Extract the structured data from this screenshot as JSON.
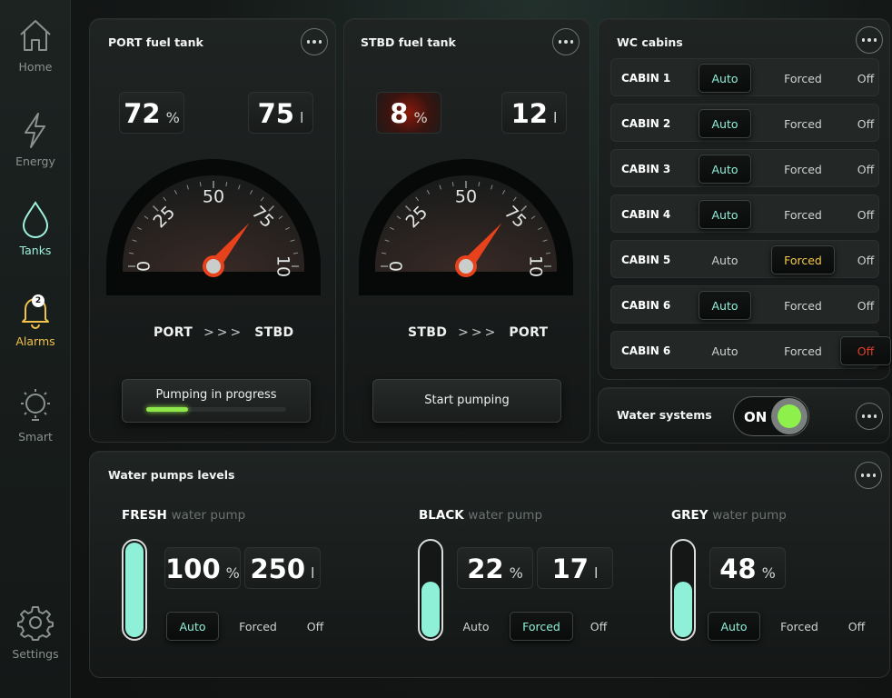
{
  "nav": {
    "home": "Home",
    "energy": "Energy",
    "tanks": "Tanks",
    "alarms": "Alarms",
    "alarms_badge": "2",
    "smart": "Smart",
    "settings": "Settings"
  },
  "port_tank": {
    "title": "PORT fuel tank",
    "percent": "72",
    "percent_unit": "%",
    "liters": "75",
    "liters_unit": "l",
    "gauge_level": 72,
    "gauge_ticks": [
      "0",
      "25",
      "50",
      "75",
      "10"
    ],
    "flow_from": "PORT",
    "flow_arrows": ">>>",
    "flow_to": "STBD",
    "action_label": "Pumping in progress",
    "progress": 0.3
  },
  "stbd_tank": {
    "title": "STBD fuel tank",
    "percent": "8",
    "percent_unit": "%",
    "liters": "12",
    "liters_unit": "l",
    "gauge_level": 72,
    "gauge_ticks": [
      "0",
      "25",
      "50",
      "75",
      "10"
    ],
    "flow_from": "STBD",
    "flow_arrows": ">>>",
    "flow_to": "PORT",
    "action_label": "Start pumping"
  },
  "wc": {
    "title": "WC cabins",
    "options": [
      "Auto",
      "Forced",
      "Off"
    ],
    "cabins": [
      {
        "name": "CABIN 1",
        "selected": "auto"
      },
      {
        "name": "CABIN 2",
        "selected": "auto"
      },
      {
        "name": "CABIN 3",
        "selected": "auto"
      },
      {
        "name": "CABIN 4",
        "selected": "auto"
      },
      {
        "name": "CABIN 5",
        "selected": "forced"
      },
      {
        "name": "CABIN 6",
        "selected": "auto"
      },
      {
        "name": "CABIN 6",
        "selected": "off"
      }
    ]
  },
  "water_systems": {
    "title": "Water systems",
    "toggle_label": "ON",
    "on": true
  },
  "pumps": {
    "title": "Water pumps levels",
    "options": [
      "Auto",
      "Forced",
      "Off"
    ],
    "fresh": {
      "name": "FRESH",
      "sub": "water pump",
      "percent": "100",
      "percent_unit": "%",
      "liters": "250",
      "liters_unit": "l",
      "level": 1.0,
      "selected": "auto"
    },
    "black": {
      "name": "BLACK",
      "sub": "water pump",
      "percent": "22",
      "percent_unit": "%",
      "liters": "17",
      "liters_unit": "l",
      "level": 0.6,
      "selected": "forced"
    },
    "grey": {
      "name": "GREY",
      "sub": "water pump",
      "percent": "48",
      "percent_unit": "%",
      "level": 0.6,
      "selected": "auto"
    }
  },
  "colors": {
    "accent": "#8ff0d8",
    "alarm": "#f2c14b",
    "needle": "#e8421c",
    "progress": "#8fe84a"
  }
}
